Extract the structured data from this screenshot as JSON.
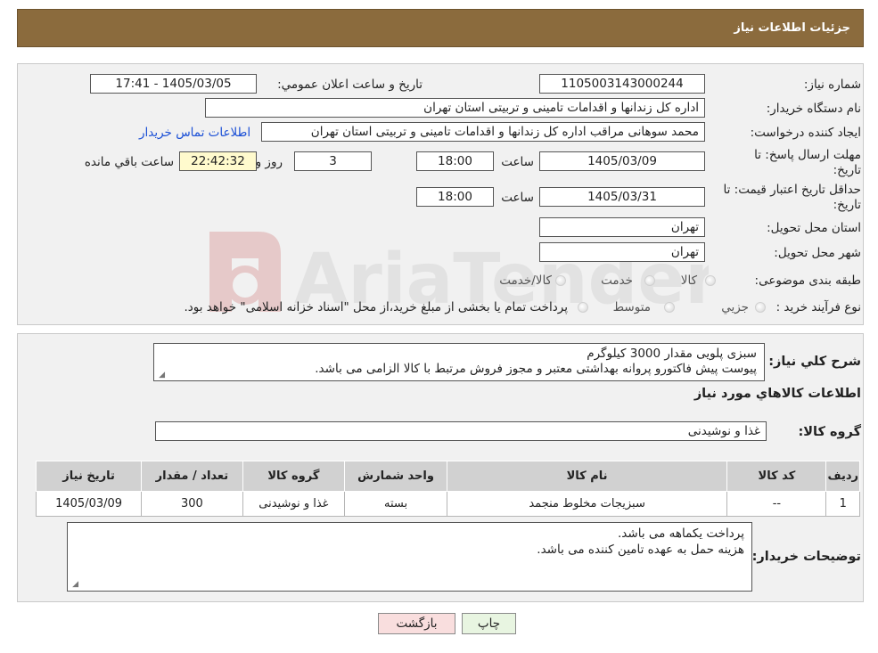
{
  "header": {
    "title": "جزئیات اطلاعات نیاز"
  },
  "form": {
    "need_number_label": "شماره نیاز:",
    "need_number": "1105003143000244",
    "announce_label": "تاريخ و ساعت اعلان عمومي:",
    "announce_value": "1405/03/05 - 17:41",
    "buyer_org_label": "نام دستگاه خريدار:",
    "buyer_org": "اداره کل زندانها و اقدامات تامینی و تربیتی استان تهران",
    "requester_label": "ايجاد کننده درخواست:",
    "requester": "محمد سوهانی مراقب  اداره کل زندانها و اقدامات تامینی و تربیتی استان تهران",
    "contact_link": "اطلاعات تماس خريدار",
    "deadline_label": "مهلت ارسال پاسخ: تا تاريخ:",
    "deadline_date": "1405/03/09",
    "time_label": "ساعت",
    "deadline_time": "18:00",
    "days": "3",
    "days_label": "روز و",
    "remaining": "22:42:32",
    "remaining_label": "ساعت باقي مانده",
    "validity_label": "حداقل تاريخ اعتبار قيمت: تا تاريخ:",
    "validity_date": "1405/03/31",
    "validity_time": "18:00",
    "province_label": "استان محل تحويل:",
    "province": "تهران",
    "city_label": "شهر محل تحويل:",
    "city": "تهران",
    "category_label": "طبقه بندی موضوعی:",
    "category_options": [
      "کالا",
      "خدمت",
      "کالا/خدمت"
    ],
    "purchase_type_label": "نوع فرآيند خريد :",
    "purchase_options": [
      "جزيي",
      "متوسط"
    ],
    "purchase_note": "پرداخت تمام يا بخشی از مبلغ خريد،از محل \"اسناد خزانه اسلامی\" خواهد بود."
  },
  "summary": {
    "label": "شرح کلي نياز:",
    "text": "سبزی پلویی مقدار 3000 کیلوگرم\nپیوست پیش فاکتورو پروانه بهداشتی معتبر و مجوز فروش مرتبط با کالا الزامی می باشد.",
    "goods_info_title": "اطلاعات کالاهاي مورد نياز",
    "group_label": "گروه کالا:",
    "group_value": "غذا و نوشیدنی"
  },
  "table": {
    "headers": [
      "رديف",
      "کد کالا",
      "نام کالا",
      "واحد شمارش",
      "گروه کالا",
      "تعداد / مقدار",
      "تاريخ نياز"
    ],
    "rows": [
      [
        "1",
        "--",
        "سبزیجات مخلوط منجمد",
        "بسته",
        "غذا و نوشیدنی",
        "300",
        "1405/03/09"
      ]
    ]
  },
  "buyer_notes": {
    "label": "توضيحات خريدار:",
    "text": "پرداخت یکماهه می باشد.\nهزینه حمل به عهده تامین کننده می باشد."
  },
  "buttons": {
    "print": "چاپ",
    "back": "بازگشت"
  },
  "watermark": {
    "text": "AriaTender.neT"
  },
  "colors": {
    "header_bg": "#8b6b3d",
    "link": "#1a4fd6",
    "back_button_bg": "#f9dede",
    "print_button_bg": "#e8f5e1"
  }
}
